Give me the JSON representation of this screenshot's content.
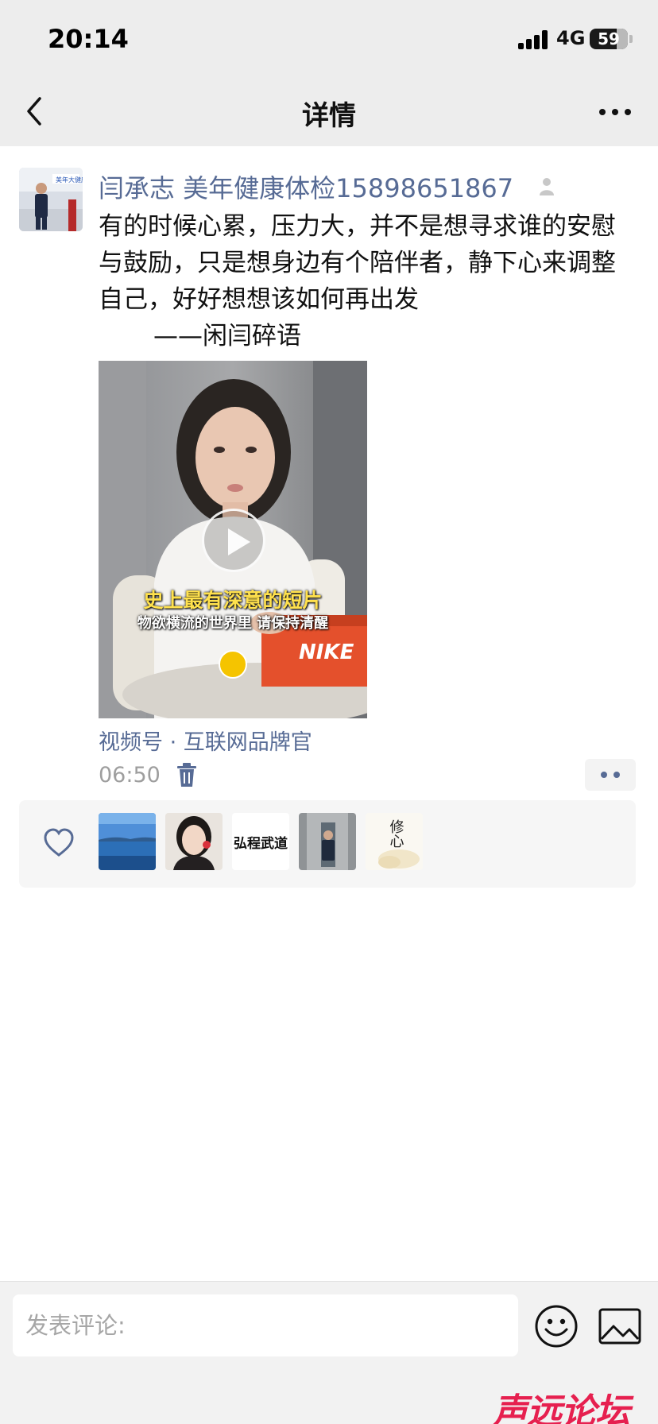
{
  "status_bar": {
    "time": "20:14",
    "network": "4G",
    "battery": "59"
  },
  "nav": {
    "title": "详情"
  },
  "post": {
    "author": "闫承志 美年健康体检15898651867",
    "text": "有的时候心累，压力大，并不是想寻求谁的安慰与鼓励，只是想身边有个陪伴者，静下心来调整自己，好好想想该如何再出发\n       ——闲闫碎语",
    "video": {
      "caption_main": "史上最有深意的短片",
      "caption_sub": "物欲横流的世界里 请保持清醒",
      "shoebox_brand": "NIKE"
    },
    "channel": "视频号 · 互联网品牌官",
    "time": "06:50"
  },
  "likes": {
    "avatars": [
      {
        "name": "like-avatar-lake"
      },
      {
        "name": "like-avatar-woman"
      },
      {
        "name": "like-avatar-calligraphy",
        "text": "弘程武道"
      },
      {
        "name": "like-avatar-man"
      },
      {
        "name": "like-avatar-xiuxin",
        "text": "修心"
      }
    ]
  },
  "comment": {
    "placeholder": "发表评论:"
  },
  "watermark": "声远论坛",
  "colors": {
    "link": "#576b95",
    "bar_bg": "#ededed",
    "watermark": "#e6204f"
  }
}
